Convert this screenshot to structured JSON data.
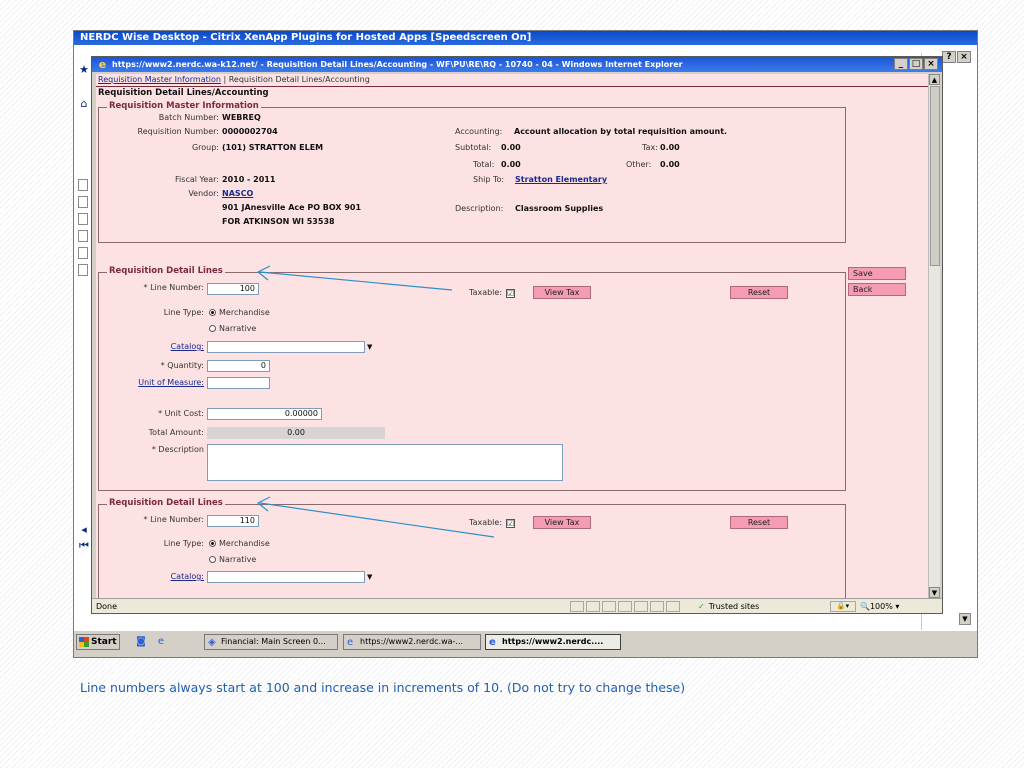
{
  "citrix": {
    "title": "NERDC Wise Desktop - Citrix XenApp Plugins for Hosted Apps [Speedscreen On]"
  },
  "ie": {
    "title": "https://www2.nerdc.wa-k12.net/ - Requisition Detail Lines/Accounting - WF\\PU\\RE\\RQ - 10740 - 04 - Windows Internet Explorer",
    "status_text": "Done",
    "trusted_sites": "Trusted sites",
    "zoom": "100%"
  },
  "breadcrumb": {
    "link": "Requisition Master Information",
    "separator": "|",
    "current": "Requisition Detail Lines/Accounting"
  },
  "page_title": "Requisition Detail Lines/Accounting",
  "master": {
    "legend": "Requisition Master Information",
    "batch_label": "Batch Number:",
    "batch_value": "WEBREQ",
    "req_label": "Requisition Number:",
    "req_value": "0000002704",
    "group_label": "Group:",
    "group_value": "(101) STRATTON ELEM",
    "fiscal_label": "Fiscal Year:",
    "fiscal_value": "2010 - 2011",
    "vendor_label": "Vendor:",
    "vendor_name": "NASCO",
    "vendor_addr1": "901 JAnesville Ace PO BOX 901",
    "vendor_addr2": "FOR ATKINSON WI 53538",
    "accounting_label": "Accounting:",
    "accounting_value": "Account allocation by total requisition amount.",
    "subtotal_label": "Subtotal:",
    "subtotal_value": "0.00",
    "tax_label": "Tax:",
    "tax_value": "0.00",
    "total_label": "Total:",
    "total_value": "0.00",
    "other_label": "Other:",
    "other_value": "0.00",
    "shipto_label": "Ship To:",
    "shipto_value": "Stratton Elementary",
    "description_label": "Description:",
    "description_value": "Classroom Supplies"
  },
  "side_buttons": {
    "save": "Save",
    "back": "Back"
  },
  "lines": [
    {
      "legend": "Requisition Detail Lines",
      "line_number_label": "* Line Number:",
      "line_number": "100",
      "line_type_label": "Line Type:",
      "merchandise": "Merchandise",
      "narrative": "Narrative",
      "catalog_label": "Catalog:",
      "quantity_label": "* Quantity:",
      "quantity": "0",
      "uom_label": "Unit of Measure:",
      "unit_cost_label": "* Unit Cost:",
      "unit_cost": "0.00000",
      "total_amount_label": "Total Amount:",
      "total_amount": "0.00",
      "description_label": "* Description",
      "taxable_label": "Taxable:",
      "taxable_mark": "☑",
      "view_tax": "View Tax",
      "reset": "Reset"
    },
    {
      "legend": "Requisition Detail Lines",
      "line_number_label": "* Line Number:",
      "line_number": "110",
      "line_type_label": "Line Type:",
      "merchandise": "Merchandise",
      "narrative": "Narrative",
      "catalog_label": "Catalog:",
      "taxable_label": "Taxable:",
      "taxable_mark": "☑",
      "view_tax": "View Tax",
      "reset": "Reset"
    }
  ],
  "taskbar": {
    "start": "Start",
    "items": [
      "Financial: Main Screen 0...",
      "https://www2.nerdc.wa-...",
      "https://www2.nerdc...."
    ]
  },
  "caption": "Line numbers always start at 100 and increase in increments of 10. (Do not try to change these)",
  "colors": {
    "page_background": "#fde2e4",
    "button_pink": "#f59bb3",
    "accent_maroon": "#7b2a40",
    "caption_blue": "#1f5fb0",
    "annotation_arrow": "#2e8fc8"
  }
}
